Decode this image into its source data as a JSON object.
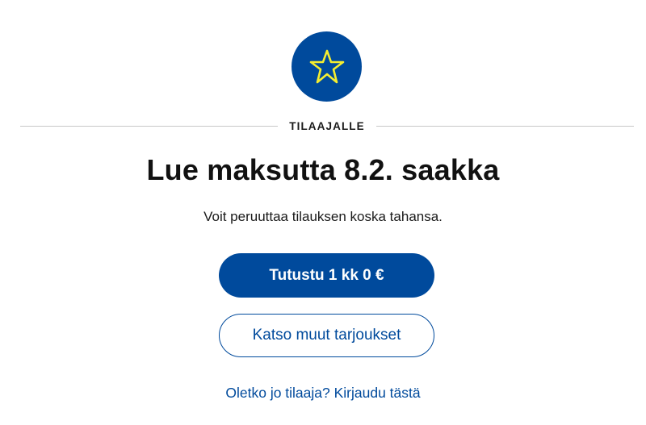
{
  "badge": {
    "icon": "star-icon",
    "background_color": "#004a9c",
    "icon_color": "#f5ee30"
  },
  "divider": {
    "label": "TILAAJALLE"
  },
  "offer": {
    "headline": "Lue maksutta 8.2. saakka",
    "subtext": "Voit peruuttaa tilauksen koska tahansa."
  },
  "actions": {
    "primary_label": "Tutustu 1 kk 0 €",
    "secondary_label": "Katso muut tarjoukset",
    "login_link": "Oletko jo tilaaja? Kirjaudu tästä"
  },
  "colors": {
    "brand_blue": "#004a9c",
    "divider_gray": "#c8c8c8"
  }
}
